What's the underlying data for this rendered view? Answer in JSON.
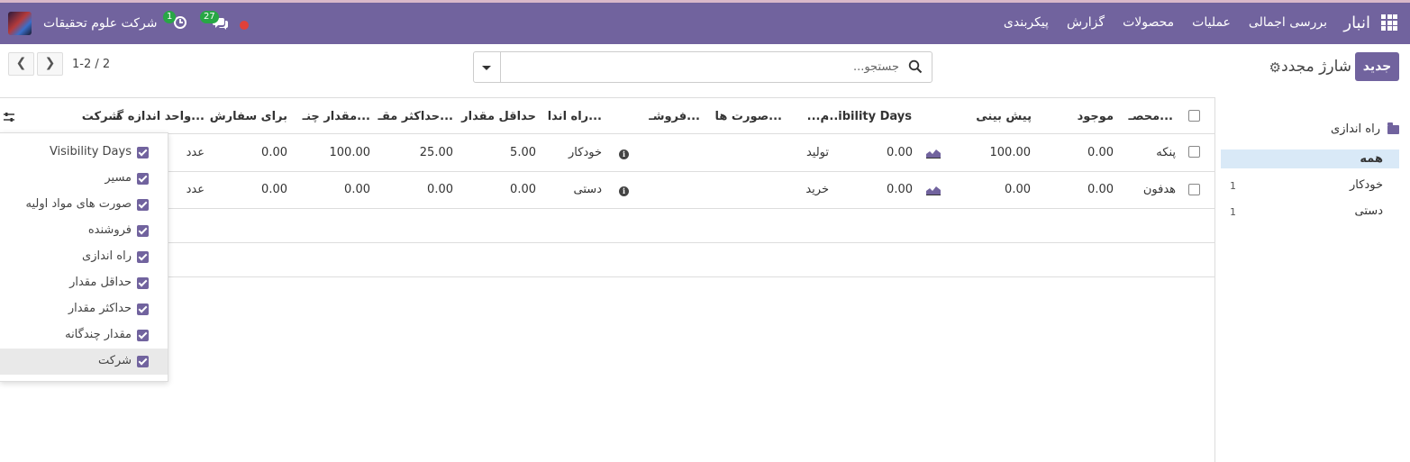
{
  "topbar": {
    "brand": "انبار",
    "menu": [
      "بررسی اجمالی",
      "عملیات",
      "محصولات",
      "گزارش",
      "پیکربندی"
    ],
    "company": "شرکت علوم تحقیقات",
    "messages_badge": "27",
    "activities_badge": "1"
  },
  "control": {
    "new_button": "جدید",
    "title": "شارژ مجدد",
    "search_placeholder": "جستجو...",
    "pager": "1-2 / 2"
  },
  "sidebar": {
    "folder": "راه اندازی",
    "all": "همه",
    "items": [
      {
        "label": "خودکار",
        "count": "1"
      },
      {
        "label": "دستی",
        "count": "1"
      }
    ]
  },
  "table": {
    "headers": {
      "product": "محصـ...",
      "on_hand": "موجود",
      "forecast": "پیش بینی",
      "visibility": "...ibility Days",
      "m": "...م",
      "bom": "صورت ها...",
      "vendor": "فروشـ...",
      "trigger": "راه اندا...",
      "min_qty": "حداقل مقدار",
      "max_qty": "حداکثر مقـ...",
      "multiple": "مقدار چنـ...",
      "to_order": "برای سفارش",
      "uom": "واحد اندازه گـ...",
      "company": "شرکت"
    },
    "rows": [
      {
        "product": "پنکه",
        "on_hand": "0.00",
        "forecast": "100.00",
        "visibility": "0.00",
        "route": "تولید",
        "trigger": "خودکار",
        "min_qty": "5.00",
        "max_qty": "25.00",
        "multiple": "100.00",
        "to_order": "0.00",
        "uom": "عدد"
      },
      {
        "product": "هدفون",
        "on_hand": "0.00",
        "forecast": "0.00",
        "visibility": "0.00",
        "route": "خرید",
        "trigger": "دستی",
        "min_qty": "0.00",
        "max_qty": "0.00",
        "multiple": "0.00",
        "to_order": "0.00",
        "uom": "عدد"
      }
    ]
  },
  "columns_menu": [
    "Visibility Days",
    "مسیر",
    "صورت های مواد اولیه",
    "فروشنده",
    "راه اندازی",
    "حداقل مقدار",
    "حداکثر مقدار",
    "مقدار چندگانه",
    "شرکت"
  ],
  "colors": {
    "brand": "#71639e",
    "badge": "#28a745",
    "record": "#e0413a",
    "selected": "#d9e9f7"
  }
}
